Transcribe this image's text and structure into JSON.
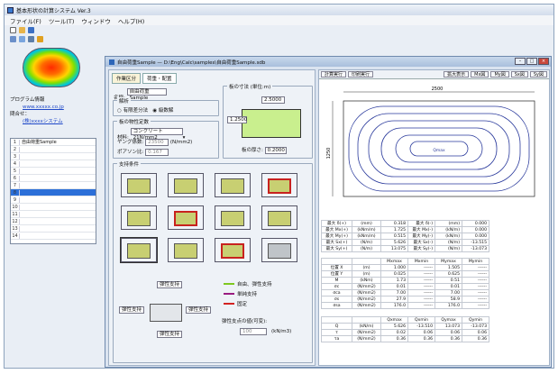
{
  "app": {
    "title": "基本形状の計算システム Ver.3"
  },
  "menu": [
    "ファイル(F)",
    "ツール(T)",
    "ウィンドウ",
    "ヘルプ(H)"
  ],
  "left": {
    "info_label1": "プログラム情報",
    "link1": "www.xxxxx.co.jp",
    "info_label2": "問合せ：",
    "link2": "(株)xxxxシステム",
    "list_rows": [
      {
        "n": "1",
        "label": "自由荷重Sample"
      },
      {
        "n": "2",
        "label": ""
      },
      {
        "n": "3",
        "label": ""
      },
      {
        "n": "4",
        "label": ""
      },
      {
        "n": "5",
        "label": ""
      },
      {
        "n": "6",
        "label": ""
      },
      {
        "n": "7",
        "label": ""
      },
      {
        "n": "8",
        "label": ""
      },
      {
        "n": "9",
        "label": ""
      },
      {
        "n": "10",
        "label": ""
      },
      {
        "n": "11",
        "label": ""
      },
      {
        "n": "12",
        "label": ""
      },
      {
        "n": "13",
        "label": ""
      },
      {
        "n": "14",
        "label": ""
      }
    ]
  },
  "child": {
    "title": "自由荷重Sample — D:\\Eng\\Calc\\samples\\自由荷重Sample.sdb",
    "tabs": [
      "作業区分",
      "荷重・配置"
    ],
    "name_label": "名称:",
    "name_value": "自由荷重Sample",
    "method_label": "解析",
    "method_opt1": "有限差分法",
    "method_opt2": "級数解",
    "material_group": "板の物性定数",
    "material_label": "材料:",
    "material_value": "コンクリート 21N/mm2",
    "young_label": "ヤング係数:",
    "young_value": "23500",
    "young_unit": "(N/mm2)",
    "poisson_label": "ポアソン比:",
    "poisson_value": "0.167",
    "dims_group": "板の寸法 (単位:m)",
    "dim_width": "2.5000",
    "dim_height": "1.2500",
    "thick_label": "板の厚さ:",
    "thick_value": "0.2000",
    "support_group": "支持条件",
    "legend_free": "自由、弾性支持",
    "legend_simple": "単純支持",
    "legend_fixed": "固定",
    "elastic_label": "弾性支点の値(可変):",
    "elastic_unit": "(kN/m3)",
    "elastic_value": "100",
    "dropdown_opts": [
      "弾性支持",
      "弾性支持",
      "弾性支持",
      "弾性支持"
    ],
    "rtabs": [
      "計算実行",
      "印刷実行",
      "拡大表示",
      "Mx図",
      "My図",
      "Sx図",
      "Sy図"
    ],
    "contour_dim_w": "2500",
    "contour_dim_h": "1250",
    "contour_peak": "Qmax",
    "max_table": [
      [
        "最大 δ(+)",
        "(mm)",
        "0.318",
        "最大 δ(-)",
        "(mm)",
        "0.000"
      ],
      [
        "最大 Mx(+)",
        "(kNm/m)",
        "1.725",
        "最大 Mx(-)",
        "(kN/m)",
        "0.000"
      ],
      [
        "最大 My(+)",
        "(kNm/m)",
        "0.515",
        "最大 My(-)",
        "(kN/m)",
        "0.000"
      ],
      [
        "最大 Sx(+)",
        "(N/m)",
        "5.626",
        "最大 Sx(-)",
        "(N/m)",
        "-13.515"
      ],
      [
        "最大 Sy(+)",
        "(N/m)",
        "13.075",
        "最大 Sy(-)",
        "(N/m)",
        "-13.073"
      ]
    ],
    "stat_head": [
      "",
      "",
      "Mxmax",
      "Mxmin",
      "Mymax",
      "Mymin"
    ],
    "stat_rows": [
      [
        "位置 X",
        "(m)",
        "1.000",
        "------",
        "1.505",
        "------"
      ],
      [
        "位置 Y",
        "(m)",
        "0.025",
        "------",
        "0.625",
        "------"
      ],
      [
        "M",
        "(kNm)",
        "1.73",
        "------",
        "0.51",
        "------"
      ],
      [
        "σc",
        "(N/mm2)",
        "0.01",
        "------",
        "0.01",
        "------"
      ],
      [
        "σca",
        "(N/mm2)",
        "7.00",
        "------",
        "7.00",
        "------"
      ],
      [
        "σs",
        "(N/mm2)",
        "27.9",
        "------",
        "58.9",
        "------"
      ],
      [
        "σsa",
        "(N/mm2)",
        "176.0",
        "------",
        "176.0",
        "------"
      ]
    ],
    "q_head": [
      "",
      "",
      "Qxmax",
      "Qxmin",
      "Qymax",
      "Qymin"
    ],
    "q_rows": [
      [
        "Q",
        "(kN/m)",
        "5.626",
        "-13.510",
        "13.073",
        "-13.073"
      ],
      [
        "τ",
        "(N/mm2)",
        "0.02",
        "0.06",
        "0.06",
        "0.06"
      ],
      [
        "τa",
        "(N/mm2)",
        "0.36",
        "0.36",
        "0.36",
        "0.36"
      ]
    ]
  }
}
